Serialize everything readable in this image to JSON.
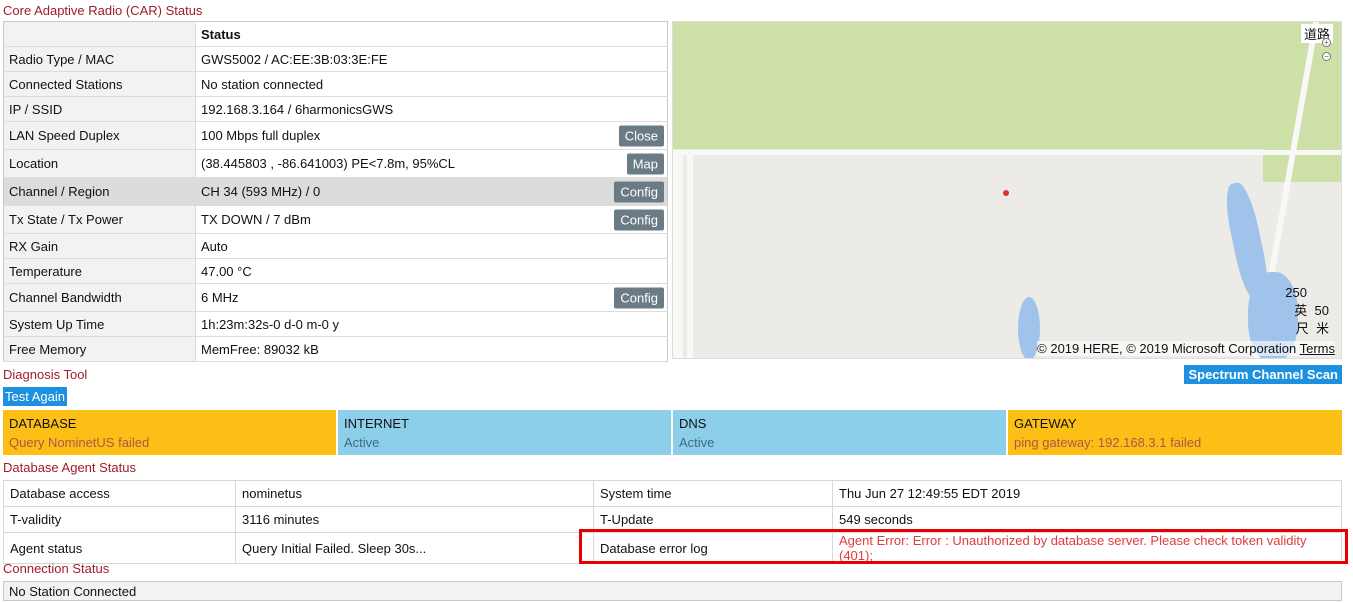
{
  "car_title": "Core Adaptive Radio (CAR) Status",
  "car_table": {
    "header_status": "Status",
    "rows": [
      {
        "key": "Radio Type / MAC",
        "value": "GWS5002 / AC:EE:3B:03:3E:FE",
        "button": ""
      },
      {
        "key": "Connected Stations",
        "value": "No station connected",
        "button": ""
      },
      {
        "key": "IP / SSID",
        "value": "192.168.3.164 / 6harmonicsGWS",
        "button": ""
      },
      {
        "key": "LAN Speed Duplex",
        "value": "100 Mbps full duplex",
        "button": "Close"
      },
      {
        "key": "Location",
        "value": "(38.445803 , -86.641003) PE<7.8m, 95%CL",
        "button": "Map"
      },
      {
        "key": "Channel / Region",
        "value": "CH 34 (593 MHz) / 0",
        "button": "Config"
      },
      {
        "key": "Tx State / Tx Power",
        "value": "TX DOWN / 7 dBm",
        "button": "Config"
      },
      {
        "key": "RX Gain",
        "value": "Auto",
        "button": ""
      },
      {
        "key": "Temperature",
        "value": "47.00 °C",
        "button": ""
      },
      {
        "key": "Channel Bandwidth",
        "value": "6 MHz",
        "button": "Config"
      },
      {
        "key": "System Up Time",
        "value": "1h:23m:32s-0 d-0 m-0 y",
        "button": ""
      },
      {
        "key": "Free Memory",
        "value": "MemFree: 89032 kB",
        "button": ""
      }
    ]
  },
  "map": {
    "road_label": "道路",
    "scale_value1": "250",
    "scale_value2": "50",
    "scale_unit1": "英",
    "scale_unit2": "尺",
    "scale_unit3": "米",
    "copyright": "© 2019 HERE, © 2019 Microsoft Corporation",
    "terms": "Terms"
  },
  "diagnosis": {
    "title": "Diagnosis Tool",
    "test_again": "Test Again",
    "spectrum_scan": "Spectrum Channel Scan",
    "cards": [
      {
        "title": "DATABASE",
        "value": "Query NominetUS failed",
        "status": "warn"
      },
      {
        "title": "INTERNET",
        "value": "Active",
        "status": "ok"
      },
      {
        "title": "DNS",
        "value": "Active",
        "status": "ok"
      },
      {
        "title": "GATEWAY",
        "value": "ping gateway: 192.168.3.1 failed",
        "status": "warn"
      }
    ],
    "colors": {
      "warn": "#fcbf16",
      "ok": "#8dcfeb"
    }
  },
  "db_agent": {
    "title": "Database Agent Status",
    "rows": [
      {
        "k1": "Database access",
        "v1": "nominetus",
        "k2": "System time",
        "v2": "Thu Jun 27 12:49:55 EDT 2019"
      },
      {
        "k1": "T-validity",
        "v1": "3116 minutes",
        "k2": "T-Update",
        "v2": "549 seconds"
      },
      {
        "k1": "Agent status",
        "v1": "Query Initial Failed. Sleep 30s...",
        "k2": "Database error log",
        "v2": "Agent Error: Error : Unauthorized by database server. Please check token validity (401);"
      }
    ]
  },
  "connection": {
    "title": "Connection Status",
    "value": "No Station Connected"
  }
}
